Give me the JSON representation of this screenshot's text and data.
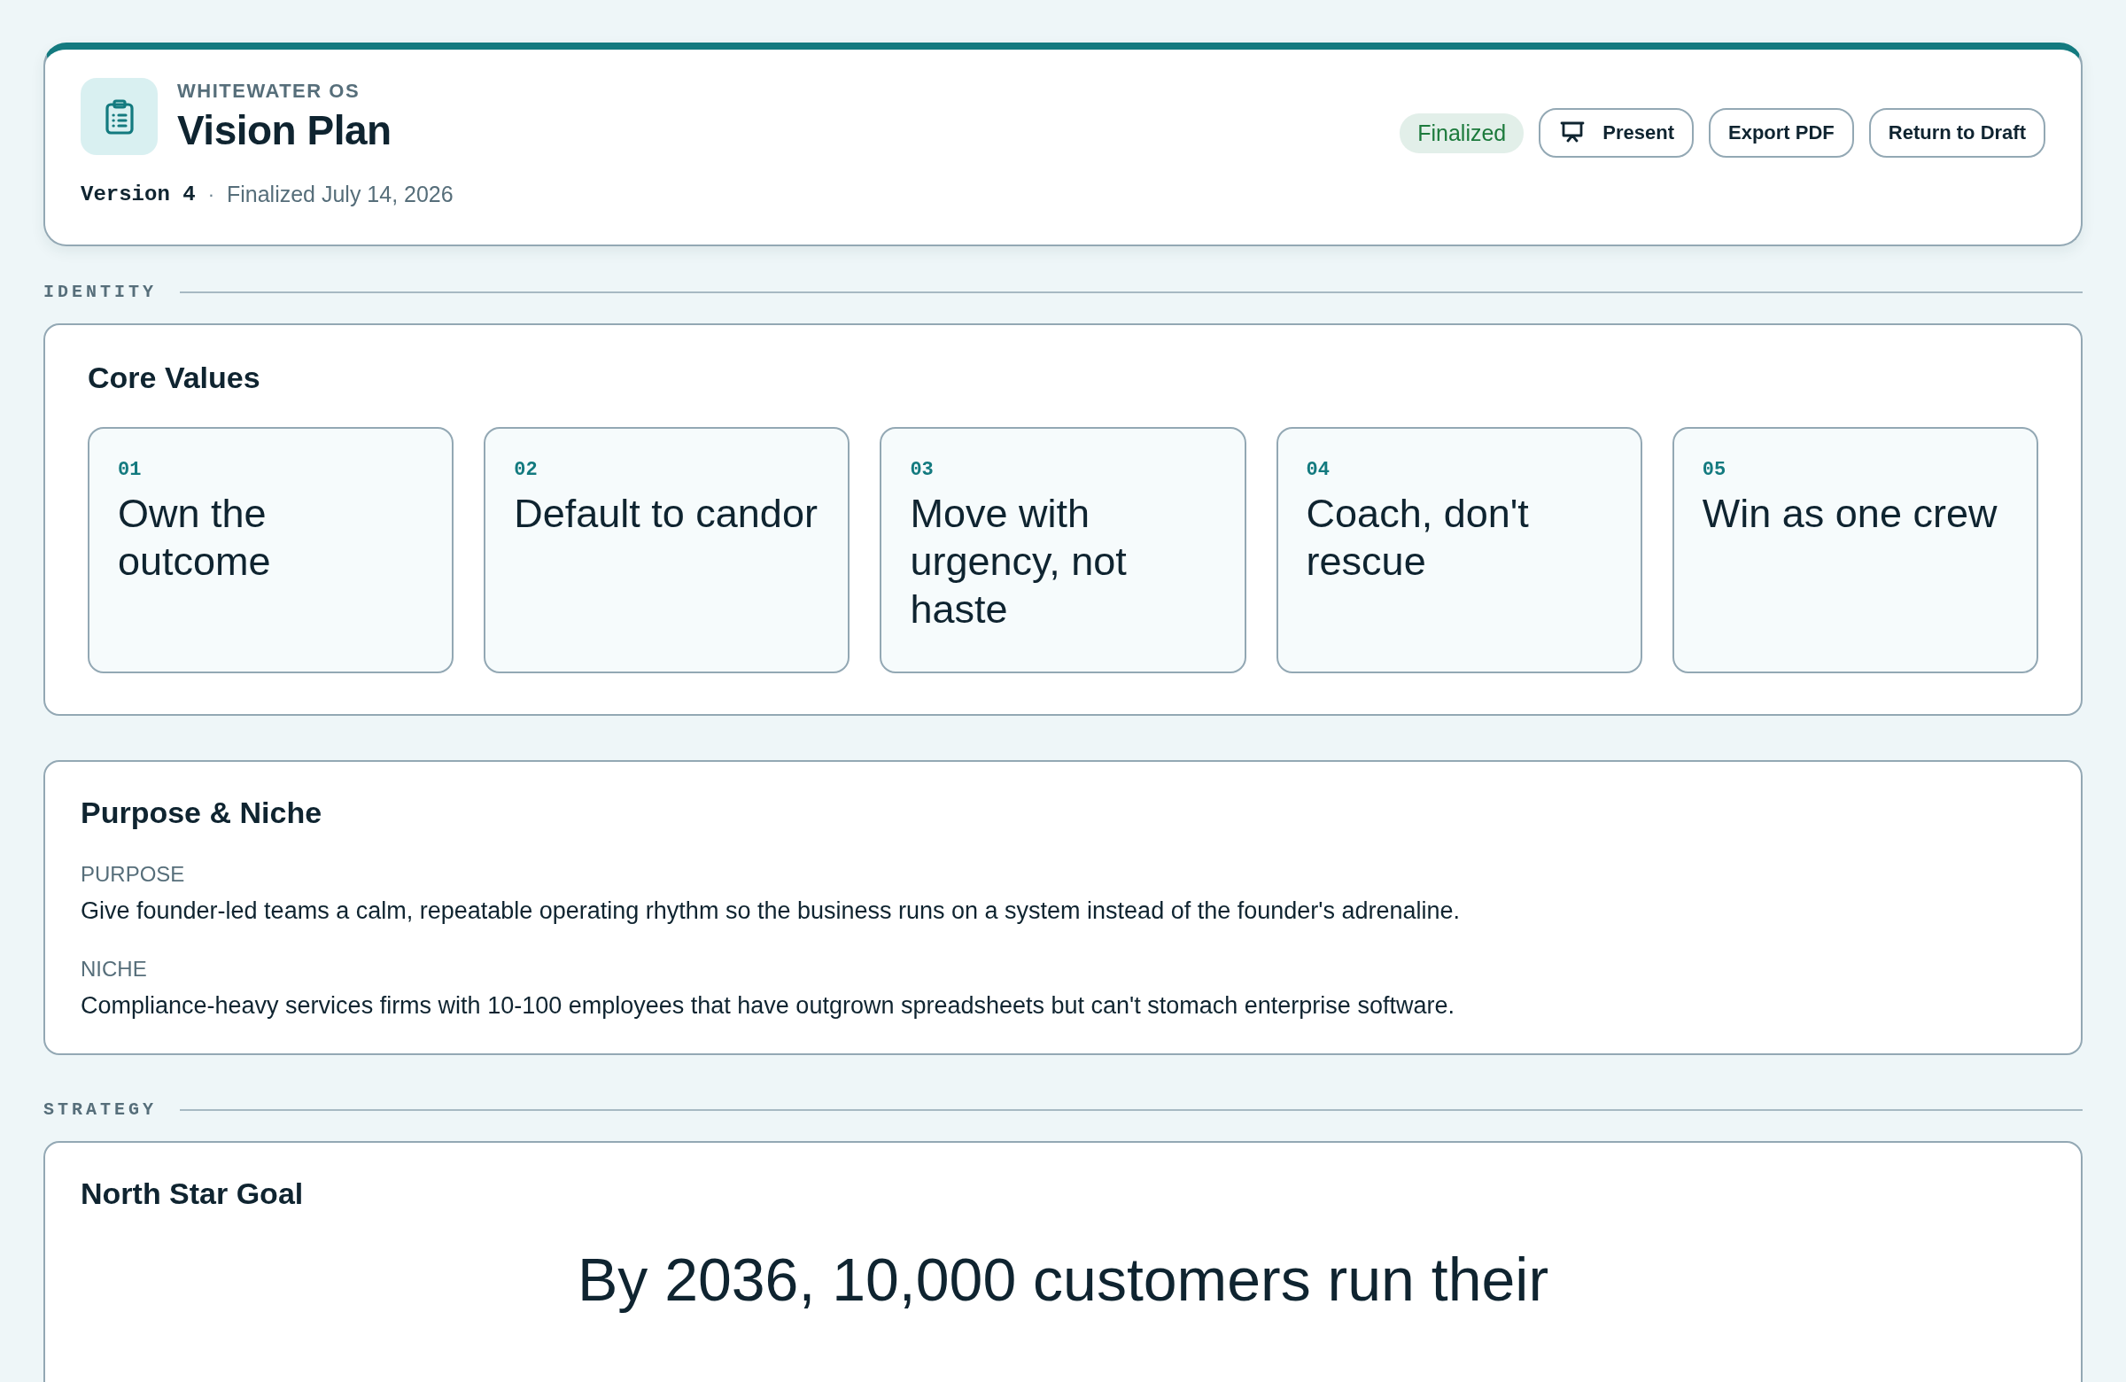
{
  "header": {
    "brand": "WHITEWATER OS",
    "title": "Vision Plan",
    "version": "Version 4",
    "separator": "·",
    "finalized_on": "Finalized July 14, 2026",
    "status": "Finalized",
    "buttons": [
      {
        "label": "Present",
        "kind": "present"
      },
      {
        "label": "Export PDF",
        "kind": "plain"
      },
      {
        "label": "Return to Draft",
        "kind": "plain"
      }
    ]
  },
  "sections": [
    {
      "label": "IDENTITY"
    },
    {
      "label": "STRATEGY"
    }
  ],
  "core_values": {
    "title": "Core Values",
    "items": [
      {
        "number": "01",
        "text": "Own the outcome"
      },
      {
        "number": "02",
        "text": "Default to candor"
      },
      {
        "number": "03",
        "text": "Move with urgency, not haste"
      },
      {
        "number": "04",
        "text": "Coach, don't rescue"
      },
      {
        "number": "05",
        "text": "Win as one crew"
      }
    ]
  },
  "purpose_niche": {
    "title": "Purpose & Niche",
    "fields": [
      {
        "label": "PURPOSE",
        "text": "Give founder-led teams a calm, repeatable operating rhythm so the business runs on a system instead of the founder's adrenaline."
      },
      {
        "label": "NICHE",
        "text": "Compliance-heavy services firms with 10-100 employees that have outgrown spreadsheets but can't stomach enterprise software."
      }
    ]
  },
  "north_star": {
    "title": "North Star Goal",
    "goal": "By 2036, 10,000 customers run their"
  }
}
